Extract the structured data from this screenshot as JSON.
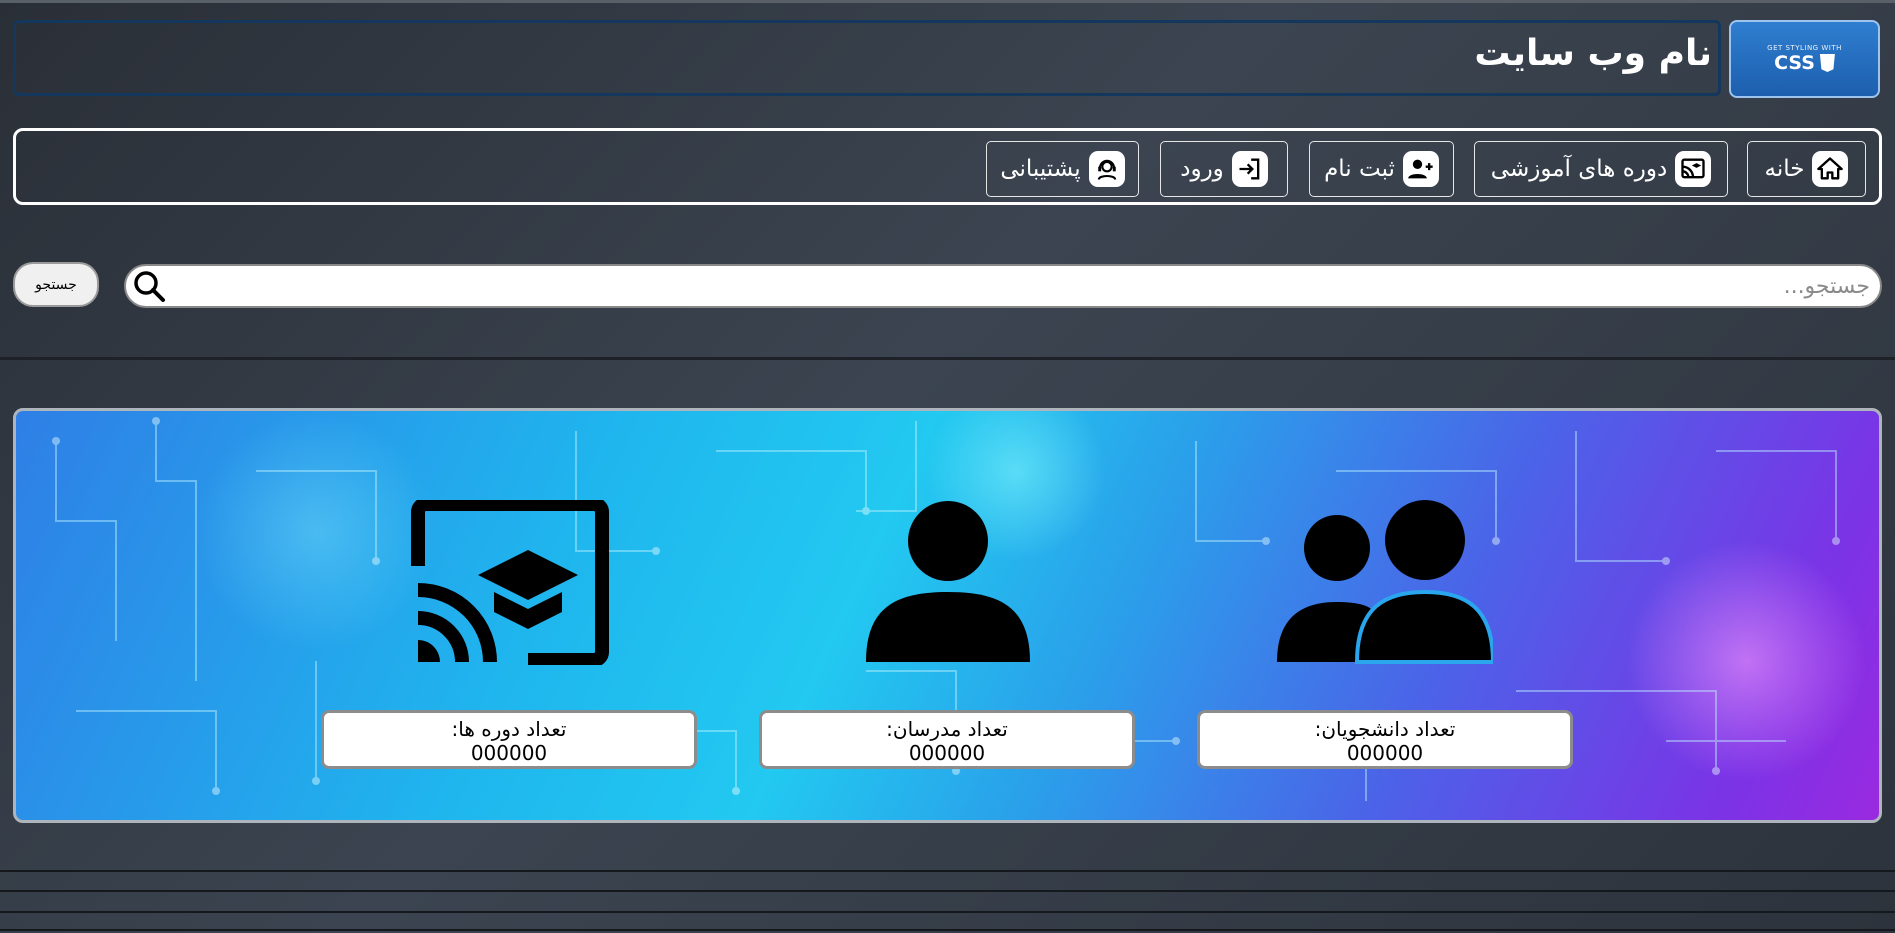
{
  "header": {
    "site_title": "نام وب سایت",
    "logo": {
      "small": "GET STYLING WITH",
      "big": "CSS"
    }
  },
  "nav": {
    "items": [
      {
        "label": "خانه",
        "icon": "home-icon"
      },
      {
        "label": "دوره های آموزشی",
        "icon": "course-cast-icon"
      },
      {
        "label": "ثبت نام",
        "icon": "user-plus-icon"
      },
      {
        "label": "ورود",
        "icon": "login-icon"
      },
      {
        "label": "پشتیبانی",
        "icon": "support-agent-icon"
      }
    ]
  },
  "search": {
    "placeholder": "جستجو...",
    "button_label": "جستجو"
  },
  "stats": [
    {
      "label": "تعداد دانشجویان:",
      "value": "000000",
      "icon": "users-icon"
    },
    {
      "label": "تعداد مدرسان:",
      "value": "000000",
      "icon": "user-icon"
    },
    {
      "label": "تعداد دوره ها:",
      "value": "000000",
      "icon": "course-cast-icon"
    }
  ],
  "colors": {
    "accent": "#1d5fae",
    "banner_start": "#2f7fe6",
    "banner_end": "#9a2ae0"
  }
}
